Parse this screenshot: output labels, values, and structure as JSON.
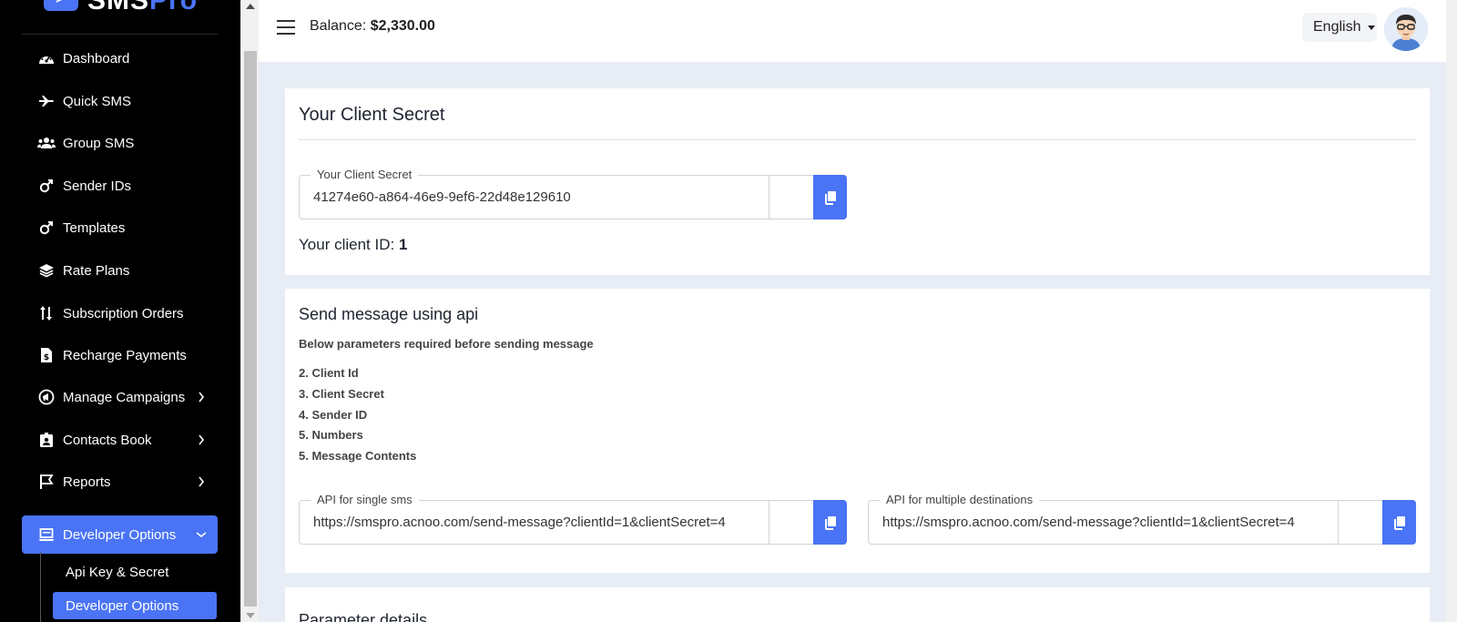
{
  "app": {
    "logo_prefix": "SMS",
    "logo_suffix": "Pro"
  },
  "header": {
    "balance_label": "Balance:",
    "balance_value": "$2,330.00",
    "language": "English"
  },
  "sidebar": {
    "items": [
      {
        "label": "Dashboard",
        "icon": "dashboard-icon"
      },
      {
        "label": "Quick SMS",
        "icon": "plane-icon"
      },
      {
        "label": "Group SMS",
        "icon": "users-icon"
      },
      {
        "label": "Sender IDs",
        "icon": "mars-icon"
      },
      {
        "label": "Templates",
        "icon": "mars-icon"
      },
      {
        "label": "Rate Plans",
        "icon": "layers-icon"
      },
      {
        "label": "Subscription Orders",
        "icon": "sort-icon"
      },
      {
        "label": "Recharge Payments",
        "icon": "invoice-icon"
      },
      {
        "label": "Manage Campaigns",
        "icon": "campaign-icon"
      },
      {
        "label": "Contacts Book",
        "icon": "contact-icon"
      },
      {
        "label": "Reports",
        "icon": "flag-icon"
      },
      {
        "label": "Developer Options",
        "icon": "laptop-icon"
      }
    ],
    "sub_items": [
      {
        "label": "Api Key & Secret"
      },
      {
        "label": "Developer Options"
      }
    ]
  },
  "client_secret_card": {
    "title": "Your Client Secret",
    "field_label": "Your Client Secret",
    "field_value": "41274e60-a864-46e9-9ef6-22d48e129610",
    "client_id_label": "Your client ID:",
    "client_id_value": "1"
  },
  "api_card": {
    "title": "Send message using api",
    "subtitle": "Below parameters required before sending message",
    "requirements": [
      "2. Client Id",
      "3. Client Secret",
      "4. Sender ID",
      "5. Numbers",
      "5. Message Contents"
    ],
    "single": {
      "label": "API for single sms",
      "value": "https://smspro.acnoo.com/send-message?clientId=1&clientSecret=4"
    },
    "multiple": {
      "label": "API for multiple destinations",
      "value": "https://smspro.acnoo.com/send-message?clientId=1&clientSecret=4"
    }
  },
  "params_card": {
    "title": "Parameter details"
  },
  "colors": {
    "accent": "#4a74f5",
    "sidebar_bg": "#000000",
    "page_bg": "#e8edf5"
  }
}
